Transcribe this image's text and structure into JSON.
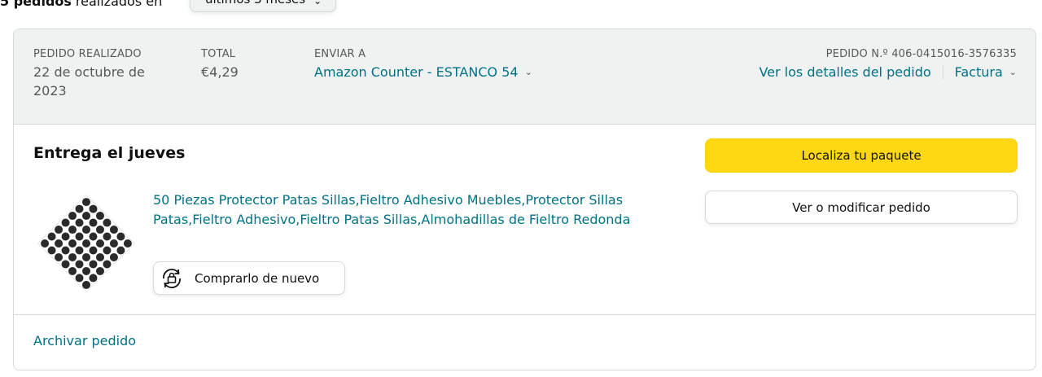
{
  "top": {
    "count_bold": "5 pedidos",
    "count_rest": "realizados en",
    "range_value": "últimos 3 meses"
  },
  "order": {
    "placed_label": "PEDIDO REALIZADO",
    "placed_value": "22 de octubre de 2023",
    "total_label": "TOTAL",
    "total_value": "€4,29",
    "ship_label": "ENVIAR A",
    "ship_value": "Amazon Counter - ESTANCO 54",
    "order_number": "PEDIDO N.º 406-0415016-3576335",
    "details_link": "Ver los detalles del pedido",
    "invoice_link": "Factura"
  },
  "shipment": {
    "status": "Entrega el jueves",
    "product_title": "50 Piezas Protector Patas Sillas,Fieltro Adhesivo Muebles,Protector Sillas Patas,Fieltro Adhesivo,Fieltro Patas Sillas,Almohadillas de Fieltro Redonda",
    "buy_again": "Comprarlo de nuevo",
    "track_button": "Localiza tu paquete",
    "modify_button": "Ver o modificar pedido"
  },
  "footer": {
    "archive_link": "Archivar pedido"
  },
  "colors": {
    "link": "#007185",
    "header_bg": "#f0f2f2",
    "primary_button": "#ffd814",
    "border": "#d5d9d9"
  },
  "icons": [
    "chevron-down-icon",
    "buy-again-icon"
  ]
}
